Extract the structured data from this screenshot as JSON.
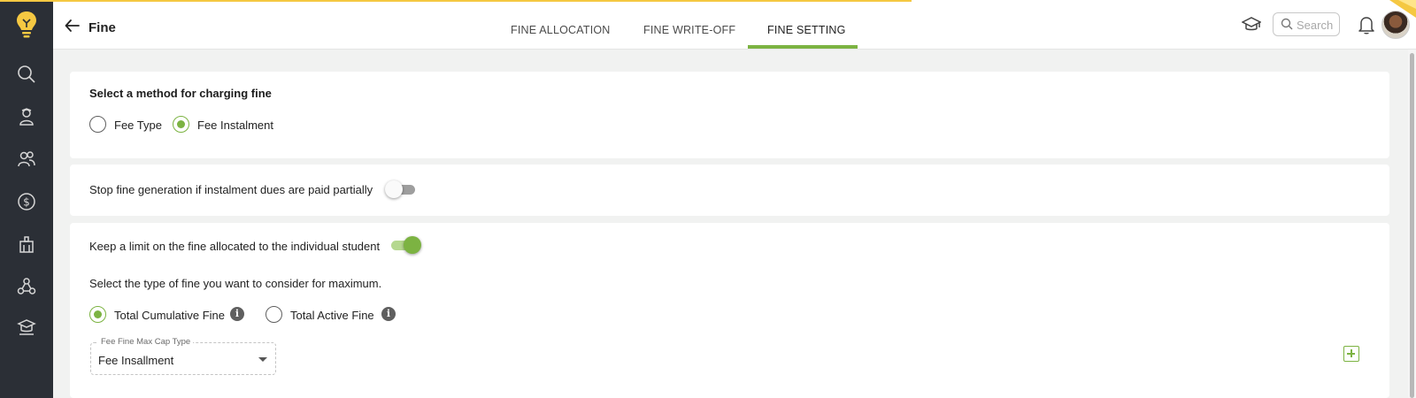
{
  "header": {
    "title": "Fine",
    "tabs": [
      {
        "label": "FINE ALLOCATION",
        "active": false
      },
      {
        "label": "FINE WRITE-OFF",
        "active": false
      },
      {
        "label": "FINE SETTING",
        "active": true
      }
    ],
    "search_placeholder": "Search",
    "icons": [
      "back-arrow-icon",
      "graduation-cap-icon",
      "search-icon",
      "bell-icon"
    ]
  },
  "sidebar": {
    "items": [
      "search-icon",
      "student-icon",
      "people-icon",
      "dollar-icon",
      "building-icon",
      "network-icon",
      "school-icon"
    ]
  },
  "method_card": {
    "title": "Select a method for charging fine",
    "options": [
      {
        "label": "Fee Type",
        "checked": false
      },
      {
        "label": "Fee Instalment",
        "checked": true
      }
    ]
  },
  "partial_card": {
    "label": "Stop fine generation if instalment dues are paid partially",
    "toggle_on": false
  },
  "limit_card": {
    "label": "Keep a limit on the fine allocated to the individual student",
    "toggle_on": true,
    "type_prompt": "Select the type of fine you want to consider for maximum.",
    "options": [
      {
        "label": "Total Cumulative Fine",
        "checked": true
      },
      {
        "label": "Total Active Fine",
        "checked": false
      }
    ],
    "select": {
      "legend": "Fee Fine Max Cap Type",
      "value": "Fee Insallment"
    }
  },
  "colors": {
    "accent": "#7cb342",
    "sidebar": "#2b2f36",
    "logo": "#f5c842"
  }
}
